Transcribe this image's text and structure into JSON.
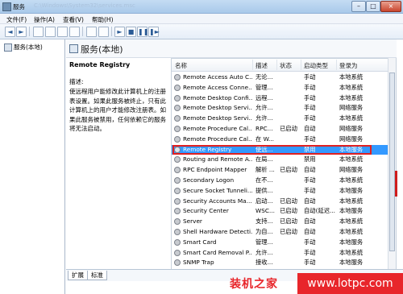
{
  "window": {
    "title": "服务",
    "title_ghost": "C:\\Windows\\System32\\services.msc",
    "buttons": {
      "minimize": "–",
      "maximize": "□",
      "close": "×"
    }
  },
  "menu": {
    "items": [
      "文件(F)",
      "操作(A)",
      "查看(V)",
      "帮助(H)"
    ]
  },
  "toolbar": {
    "back": "◄",
    "forward": "►",
    "play": "►",
    "stop": "■",
    "pause": "❚❚",
    "restart": "❚►",
    "icons": [
      "back-icon",
      "forward-icon",
      "console-icon",
      "list-icon",
      "refresh-icon",
      "export-icon",
      "help-icon",
      "properties-icon",
      "play-icon",
      "stop-icon",
      "pause-icon",
      "restart-icon"
    ]
  },
  "tree": {
    "label": "服务(本地)"
  },
  "pane": {
    "title": "服务(本地)"
  },
  "description": {
    "heading": "Remote Registry",
    "label": "描述:",
    "text": "使远程用户能修改此计算机上的注册表设置。如果此服务被终止，只有此计算机上的用户才能修改注册表。如果此服务被禁用，任何依赖它的服务将无法启动。"
  },
  "table": {
    "headers": [
      "名称",
      "描述",
      "状态",
      "启动类型",
      "登录为"
    ],
    "selected_index": 8,
    "rows": [
      [
        "Remote Access Auto C...",
        "无论...",
        "",
        "手动",
        "本地系统"
      ],
      [
        "Remote Access Conne...",
        "管理...",
        "",
        "手动",
        "本地系统"
      ],
      [
        "Remote Desktop Confi...",
        "远程...",
        "",
        "手动",
        "本地系统"
      ],
      [
        "Remote Desktop Servi...",
        "允许...",
        "",
        "手动",
        "网络服务"
      ],
      [
        "Remote Desktop Servi...",
        "允许...",
        "",
        "手动",
        "本地系统"
      ],
      [
        "Remote Procedure Cal...",
        "RPC...",
        "已启动",
        "自动",
        "网络服务"
      ],
      [
        "Remote Procedure Cal...",
        "在 W...",
        "",
        "手动",
        "网络服务"
      ],
      [
        "Remote Registry",
        "使远...",
        "",
        "禁用",
        "本地服务"
      ],
      [
        "Routing and Remote A...",
        "在局...",
        "",
        "禁用",
        "本地系统"
      ],
      [
        "RPC Endpoint Mapper",
        "解析 ...",
        "已启动",
        "自动",
        "网络服务"
      ],
      [
        "Secondary Logon",
        "在不...",
        "",
        "手动",
        "本地系统"
      ],
      [
        "Secure Socket Tunneli...",
        "提供...",
        "",
        "手动",
        "本地服务"
      ],
      [
        "Security Accounts Ma...",
        "启动...",
        "已启动",
        "自动",
        "本地系统"
      ],
      [
        "Security Center",
        "WSC...",
        "已启动",
        "自动(延迟...",
        "本地服务"
      ],
      [
        "Server",
        "支持...",
        "已启动",
        "自动",
        "本地系统"
      ],
      [
        "Shell Hardware Detecti...",
        "为自...",
        "已启动",
        "自动",
        "本地系统"
      ],
      [
        "Smart Card",
        "管理...",
        "",
        "手动",
        "本地服务"
      ],
      [
        "Smart Card Removal P...",
        "允许...",
        "",
        "手动",
        "本地系统"
      ],
      [
        "SNMP Trap",
        "接收...",
        "",
        "手动",
        "本地服务"
      ]
    ]
  },
  "tabs": [
    "扩展",
    "标准"
  ],
  "watermark": {
    "text1": "装机之家",
    "text2": "www.lotpc.com"
  },
  "colors": {
    "selection": "#3399ff",
    "highlight": "#e02020",
    "watermark": "#e8262b"
  }
}
